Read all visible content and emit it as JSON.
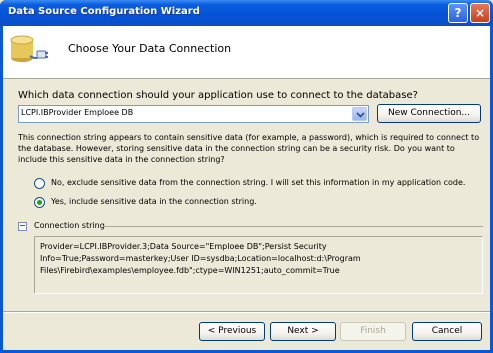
{
  "window": {
    "title": "Data Source Configuration Wizard",
    "help_label": "?",
    "close_label": "×"
  },
  "header": {
    "title": "Choose Your Data Connection"
  },
  "connection": {
    "question": "Which data connection should your application use to connect to the database?",
    "selected": "LCPI.IBProvider Emploee DB",
    "new_connection_label": "New Connection..."
  },
  "sensitive": {
    "warning": "This connection string appears to contain sensitive data (for example, a password), which is required to connect to the database. However, storing sensitive data in the connection string can be a security risk. Do you want to include this sensitive data in the connection string?",
    "option_no": "No, exclude sensitive data from the connection string. I will set this information in my application code.",
    "option_yes": "Yes, include sensitive data in the connection string.",
    "selected": "yes"
  },
  "conn_string": {
    "label": "Connection string",
    "collapse_glyph": "−",
    "lines": [
      "Provider=LCPI.IBProvider.3;Data Source=\"Emploee DB\";Persist Security",
      "Info=True;Password=masterkey;User ID=sysdba;Location=localhost:d:\\Program",
      "Files\\Firebird\\examples\\employee.fdb\";ctype=WIN1251;auto_commit=True"
    ]
  },
  "footer": {
    "previous": "< Previous",
    "next": "Next >",
    "finish": "Finish",
    "cancel": "Cancel"
  },
  "colors": {
    "titlebar": "#0553d6",
    "dialog_bg": "#ece9d8",
    "radio_selected": "#21a121"
  },
  "icons": {
    "header": "database-plug-icon",
    "combo_arrow": "chevron-down-icon"
  }
}
